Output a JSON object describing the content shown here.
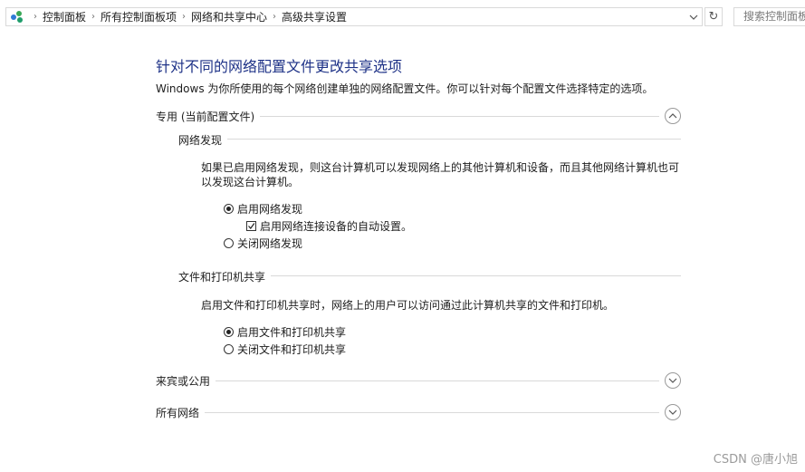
{
  "breadcrumb": {
    "items": [
      "控制面板",
      "所有控制面板项",
      "网络和共享中心",
      "高级共享设置"
    ]
  },
  "search": {
    "placeholder": "搜索控制面板"
  },
  "main": {
    "title": "针对不同的网络配置文件更改共享选项",
    "subtitle": "Windows 为你所使用的每个网络创建单独的网络配置文件。你可以针对每个配置文件选择特定的选项。",
    "private_profile": {
      "label": "专用 (当前配置文件)",
      "expanded": true,
      "network_discovery": {
        "label": "网络发现",
        "description": "如果已启用网络发现，则这台计算机可以发现网络上的其他计算机和设备，而且其他网络计算机也可以发现这台计算机。",
        "option_on": "启用网络发现",
        "auto_setup": "启用网络连接设备的自动设置。",
        "option_off": "关闭网络发现",
        "selected": "on",
        "auto_setup_checked": true
      },
      "file_printer_sharing": {
        "label": "文件和打印机共享",
        "description": "启用文件和打印机共享时，网络上的用户可以访问通过此计算机共享的文件和打印机。",
        "option_on": "启用文件和打印机共享",
        "option_off": "关闭文件和打印机共享",
        "selected": "on"
      }
    },
    "guest_public": {
      "label": "来宾或公用",
      "expanded": false
    },
    "all_networks": {
      "label": "所有网络",
      "expanded": false
    }
  },
  "watermark": "CSDN @唐小旭",
  "colors": {
    "title": "#1e3287",
    "line": "#d9d9d9"
  }
}
